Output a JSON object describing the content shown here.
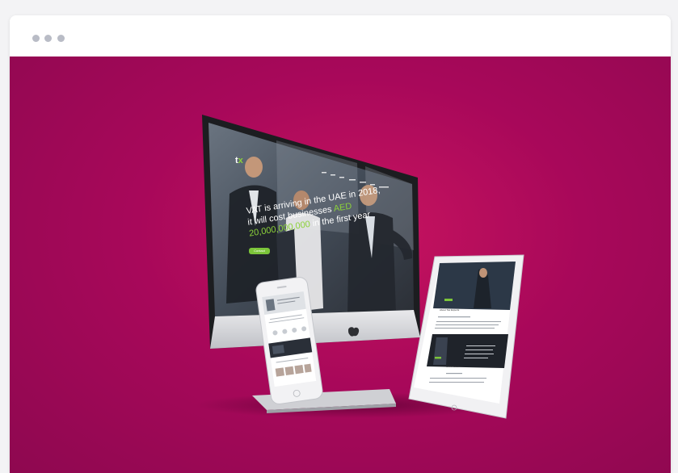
{
  "window": {
    "controls": [
      "dot",
      "dot",
      "dot"
    ]
  },
  "mockup": {
    "logo": {
      "t": "t",
      "x": "x"
    },
    "hero": {
      "line1_a": "VAT",
      "line1_b": " is arriving in the UAE in 2018,",
      "line2_a": "it will cost businesses ",
      "line2_b": "AED",
      "line3_a": "20,000,000,000",
      "line3_b": " in the first year",
      "button": "Contact"
    },
    "tablet": {
      "about_heading": "About Tax Experts",
      "contact_heading": "Get in touch"
    }
  },
  "colors": {
    "background": "#b00a5b",
    "accent_green": "#8cd23a"
  }
}
